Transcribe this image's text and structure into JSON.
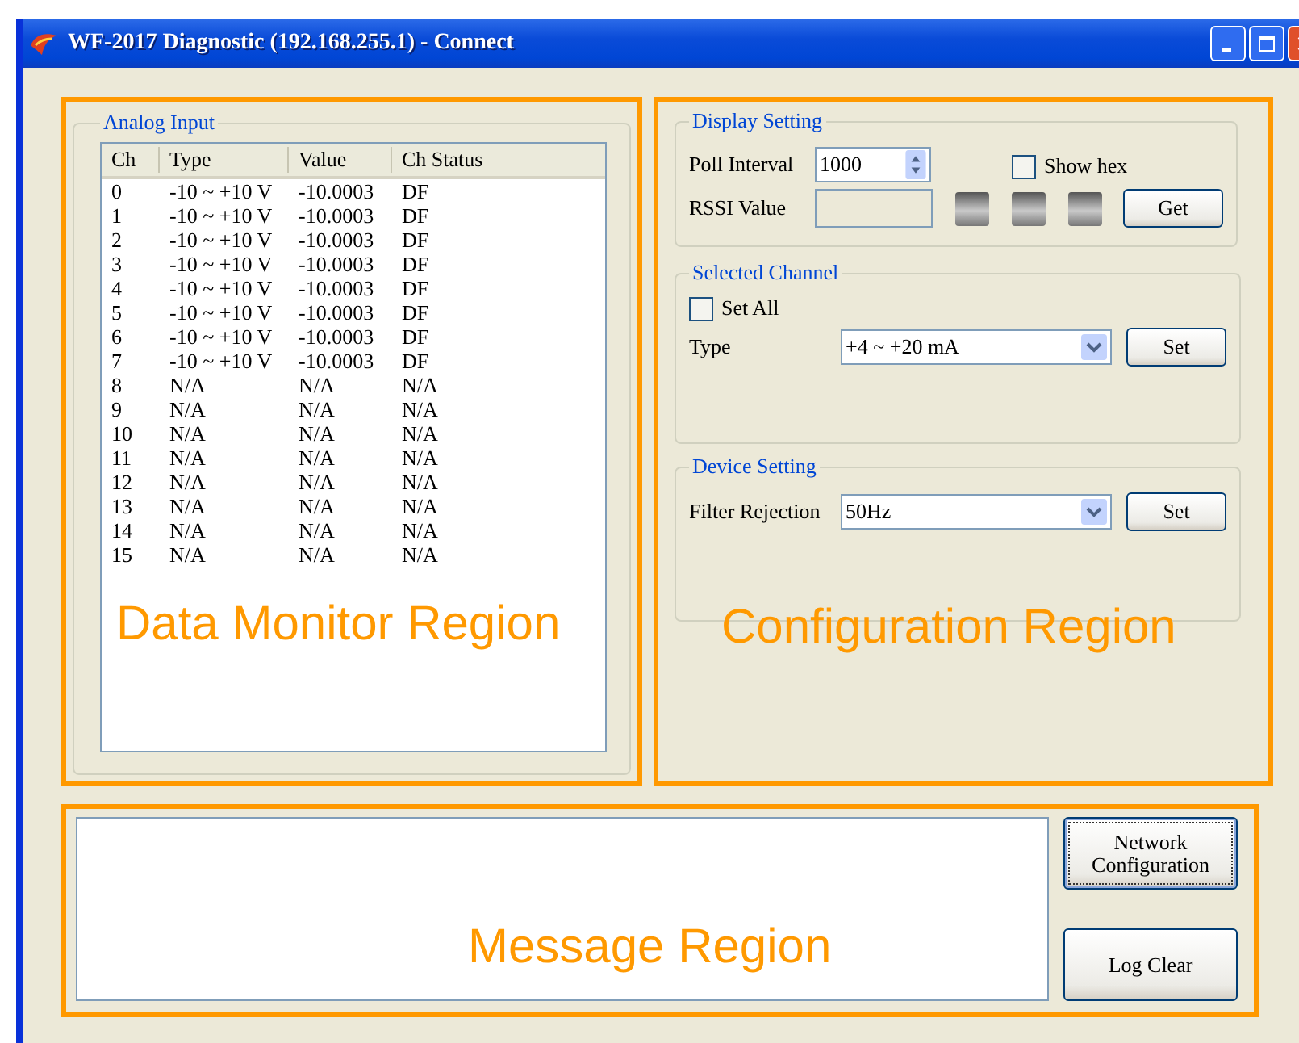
{
  "window": {
    "title": "WF-2017 Diagnostic (192.168.255.1) - Connect"
  },
  "analog_input": {
    "title": "Analog Input",
    "columns": [
      "Ch",
      "Type",
      "Value",
      "Ch Status"
    ],
    "rows": [
      [
        "0",
        "-10 ~ +10 V",
        "-10.0003",
        "DF"
      ],
      [
        "1",
        "-10 ~ +10 V",
        "-10.0003",
        "DF"
      ],
      [
        "2",
        "-10 ~ +10 V",
        "-10.0003",
        "DF"
      ],
      [
        "3",
        "-10 ~ +10 V",
        "-10.0003",
        "DF"
      ],
      [
        "4",
        "-10 ~ +10 V",
        "-10.0003",
        "DF"
      ],
      [
        "5",
        "-10 ~ +10 V",
        "-10.0003",
        "DF"
      ],
      [
        "6",
        "-10 ~ +10 V",
        "-10.0003",
        "DF"
      ],
      [
        "7",
        "-10 ~ +10 V",
        "-10.0003",
        "DF"
      ],
      [
        "8",
        "N/A",
        "N/A",
        "N/A"
      ],
      [
        "9",
        "N/A",
        "N/A",
        "N/A"
      ],
      [
        "10",
        "N/A",
        "N/A",
        "N/A"
      ],
      [
        "11",
        "N/A",
        "N/A",
        "N/A"
      ],
      [
        "12",
        "N/A",
        "N/A",
        "N/A"
      ],
      [
        "13",
        "N/A",
        "N/A",
        "N/A"
      ],
      [
        "14",
        "N/A",
        "N/A",
        "N/A"
      ],
      [
        "15",
        "N/A",
        "N/A",
        "N/A"
      ]
    ]
  },
  "display_setting": {
    "title": "Display Setting",
    "poll_label": "Poll Interval",
    "poll_value": "1000",
    "show_hex": {
      "label": "Show hex",
      "checked": false
    },
    "rssi_label": "RSSI Value",
    "button": "Get"
  },
  "selected_channel": {
    "title": "Selected Channel",
    "set_all": {
      "label": "Set All",
      "checked": false
    },
    "type_label": "Type",
    "type_value": "+4 ~ +20 mA",
    "button": "Set"
  },
  "device_setting": {
    "title": "Device Setting",
    "label": "Filter Rejection",
    "value": "50Hz",
    "button": "Set"
  },
  "message": {
    "buttons": [
      "Network Configuration",
      "Log Clear"
    ]
  },
  "region_labels": [
    "Data Monitor Region",
    "Configuration Region",
    "Message Region"
  ]
}
